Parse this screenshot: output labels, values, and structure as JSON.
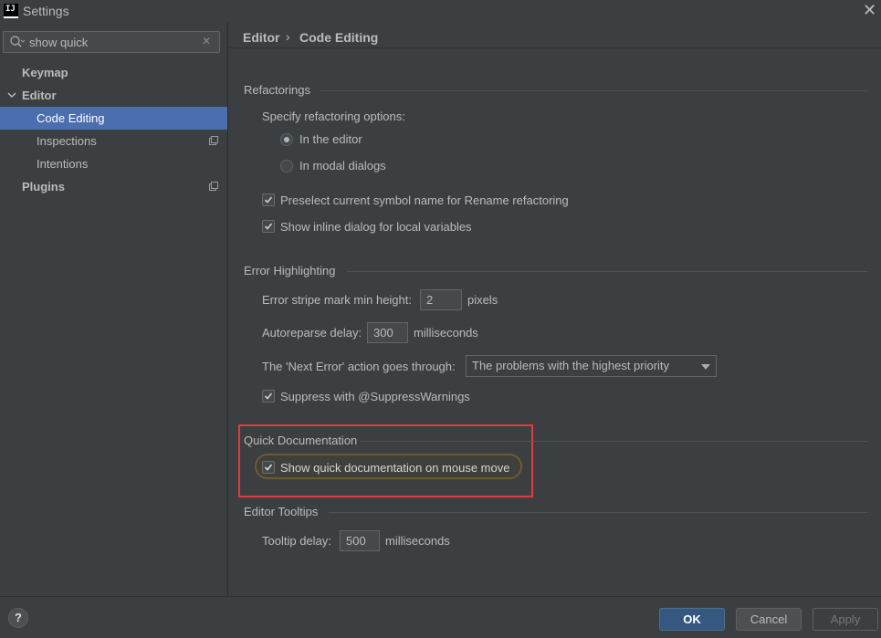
{
  "window": {
    "title": "Settings",
    "icon_text": "IJ"
  },
  "search": {
    "value": "show quick",
    "placeholder": ""
  },
  "sidebar": {
    "items": [
      {
        "label": "Keymap"
      },
      {
        "label": "Editor"
      },
      {
        "label": "Code Editing"
      },
      {
        "label": "Inspections"
      },
      {
        "label": "Intentions"
      },
      {
        "label": "Plugins"
      }
    ]
  },
  "breadcrumb": {
    "part1": "Editor",
    "separator": "›",
    "part2": "Code Editing"
  },
  "refactorings": {
    "title": "Refactorings",
    "specify_label": "Specify refactoring options:",
    "radio_editor": "In the editor",
    "radio_modal": "In modal dialogs",
    "preselect_label": "Preselect current symbol name for Rename refactoring",
    "inline_dialog_label": "Show inline dialog for local variables"
  },
  "error_highlighting": {
    "title": "Error Highlighting",
    "stripe_label": "Error stripe mark min height:",
    "stripe_value": "2",
    "stripe_unit": "pixels",
    "autoreparse_label": "Autoreparse delay:",
    "autoreparse_value": "300",
    "autoreparse_unit": "milliseconds",
    "next_error_label": "The 'Next Error' action goes through:",
    "next_error_value": "The problems with the highest priority",
    "suppress_label": "Suppress with @SuppressWarnings"
  },
  "quick_doc": {
    "title": "Quick Documentation",
    "show_label": "Show quick documentation on mouse move"
  },
  "tooltips": {
    "title": "Editor Tooltips",
    "delay_label": "Tooltip delay:",
    "delay_value": "500",
    "delay_unit": "milliseconds"
  },
  "footer": {
    "help": "?",
    "ok": "OK",
    "cancel": "Cancel",
    "apply": "Apply"
  },
  "colors": {
    "accent_selected": "#4b6eaf",
    "highlight_red": "#e03c3c",
    "primary_button": "#365880"
  }
}
